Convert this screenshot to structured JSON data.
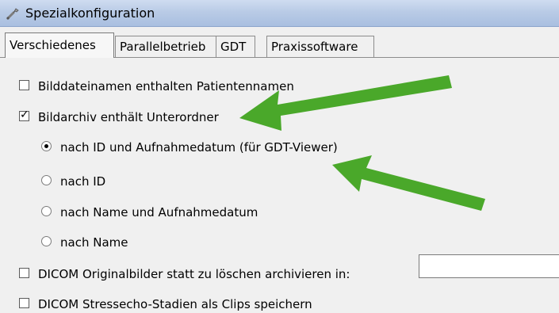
{
  "window": {
    "title": "Spezialkonfiguration",
    "icon": "wrench-icon"
  },
  "tabs": [
    {
      "label": "Verschiedenes",
      "active": true
    },
    {
      "label": "Parallelbetrieb",
      "active": false
    },
    {
      "label": "GDT",
      "active": false
    },
    {
      "label": "Praxissoftware",
      "active": false
    }
  ],
  "options": {
    "patient_names": {
      "label": "Bilddateinamen enthalten Patientennamen",
      "checked": false
    },
    "subfolders": {
      "label": "Bildarchiv enthält Unterordner",
      "checked": true
    },
    "radio_id_date": {
      "label": "nach ID und Aufnahmedatum (für GDT-Viewer)",
      "selected": true
    },
    "radio_id": {
      "label": "nach ID",
      "selected": false
    },
    "radio_name_date": {
      "label": "nach Name und Aufnahmedatum",
      "selected": false
    },
    "radio_name": {
      "label": "nach Name",
      "selected": false
    },
    "dicom_archive": {
      "label": "DICOM Originalbilder statt zu löschen archivieren in:",
      "checked": false,
      "value": ""
    },
    "dicom_stress": {
      "label": "DICOM Stressecho-Stadien als Clips speichern",
      "checked": false
    }
  },
  "colors": {
    "arrow": "#4aa82a",
    "titlebar": "#b9cbe6"
  },
  "annotations": [
    {
      "icon": "green-arrow",
      "points_to": "Bildarchiv enthält Unterordner"
    },
    {
      "icon": "green-arrow",
      "points_to": "nach ID und Aufnahmedatum (für GDT-Viewer)"
    }
  ]
}
